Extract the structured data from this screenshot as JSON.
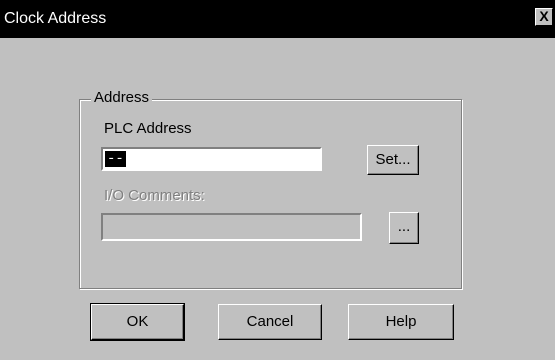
{
  "window": {
    "title": "Clock Address",
    "close_label": "X"
  },
  "address_group": {
    "legend": "Address",
    "plc_address_label": "PLC Address",
    "plc_address_value": "--",
    "set_button": "Set...",
    "io_comments_label": "I/O Comments:",
    "io_comments_value": "",
    "browse_button": "..."
  },
  "buttons": {
    "ok": "OK",
    "cancel": "Cancel",
    "help": "Help"
  }
}
